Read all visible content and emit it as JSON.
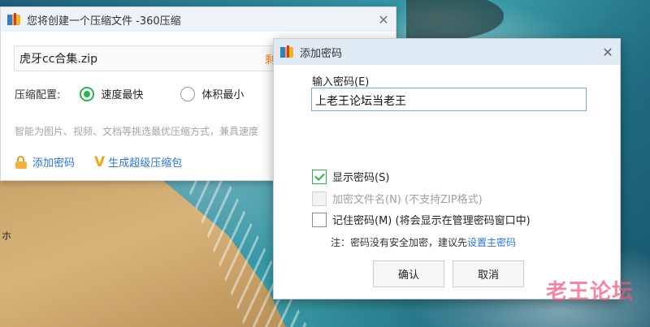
{
  "main_window": {
    "title": "您将创建一个压缩文件 -360压缩",
    "close": "✕",
    "file_name": "虎牙cc合集.zip",
    "remaining": "剩余",
    "compress_config_label": "压缩配置:",
    "options": [
      {
        "label": "速度最快",
        "selected": true
      },
      {
        "label": "体积最小",
        "selected": false
      }
    ],
    "smart_text": "智能为图片、视频、文档等挑选最优压缩方式，兼具速度",
    "add_password_link": "添加密码",
    "super_zip_link": "生成超级压缩包",
    "super_zip_icon_glyph": "V"
  },
  "dialog": {
    "title": "添加密码",
    "close": "✕",
    "input_label": "输入密码(E)",
    "password_value": "上老王论坛当老王",
    "checkboxes": [
      {
        "label": "显示密码(S)",
        "checked": true,
        "disabled": false
      },
      {
        "label": "加密文件名(N) (不支持ZIP格式)",
        "checked": false,
        "disabled": true
      },
      {
        "label": "记住密码(M) (将会显示在管理密码窗口中)",
        "checked": false,
        "disabled": false
      }
    ],
    "note_prefix": "注：密码没有安全加密，建议先",
    "note_link": "设置主密码",
    "ok_label": "确认",
    "cancel_label": "取消"
  },
  "desktop": {
    "partial_text": "ホ"
  },
  "watermark": {
    "big": "老王论坛"
  },
  "colors": {
    "accent_green": "#2bb24c",
    "link_blue": "#2a74d6",
    "orange": "#f08a1a"
  }
}
